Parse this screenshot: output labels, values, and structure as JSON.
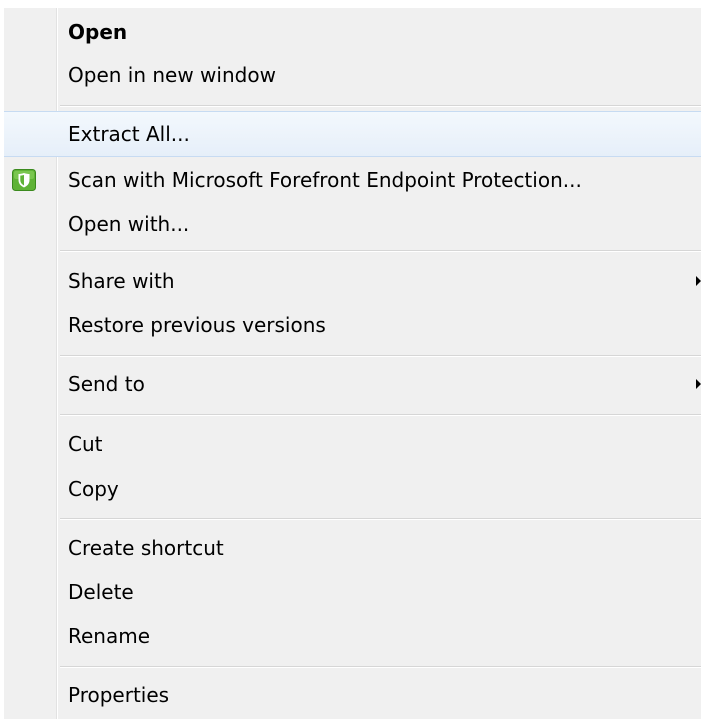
{
  "menu": {
    "items": [
      {
        "label": "Open"
      },
      {
        "label": "Open in new window"
      },
      {
        "label": "Extract All..."
      },
      {
        "label": "Scan with Microsoft Forefront Endpoint Protection..."
      },
      {
        "label": "Open with..."
      },
      {
        "label": "Share with"
      },
      {
        "label": "Restore previous versions"
      },
      {
        "label": "Send to"
      },
      {
        "label": "Cut"
      },
      {
        "label": "Copy"
      },
      {
        "label": "Create shortcut"
      },
      {
        "label": "Delete"
      },
      {
        "label": "Rename"
      },
      {
        "label": "Properties"
      }
    ],
    "icons": {
      "scan_icon": "forefront-shield-icon",
      "submenu_arrow": "submenu-arrow-icon"
    },
    "colors": {
      "background": "#f0f0f0",
      "highlight": "#e6eff9",
      "highlight_border": "#c7dbf2",
      "shield_green": "#5fb336"
    }
  }
}
